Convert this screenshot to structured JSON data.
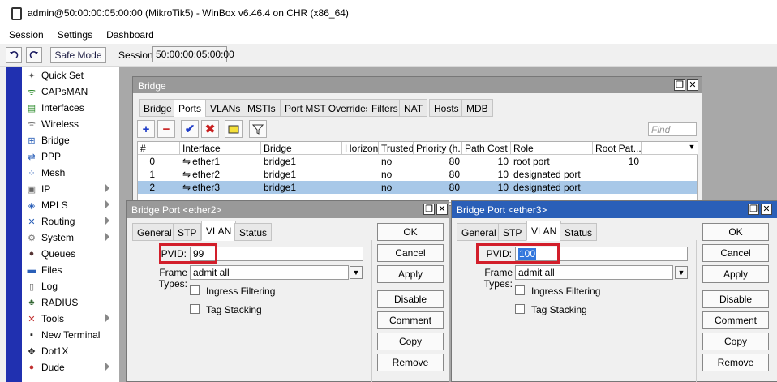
{
  "window": {
    "title": "admin@50:00:00:05:00:00 (MikroTik5) - WinBox v6.46.4 on CHR (x86_64)"
  },
  "menu": [
    "Session",
    "Settings",
    "Dashboard"
  ],
  "toolbar": {
    "undo_icon": "undo-icon",
    "redo_icon": "redo-icon",
    "safe_mode": "Safe Mode",
    "session_label": "Session:",
    "session_value": "50:00:00:05:00:00"
  },
  "sidebar": [
    {
      "label": "Quick Set",
      "icon": "wand-icon",
      "arrow": false
    },
    {
      "label": "CAPsMAN",
      "icon": "antenna-icon",
      "arrow": false
    },
    {
      "label": "Interfaces",
      "icon": "interfaces-icon",
      "arrow": false
    },
    {
      "label": "Wireless",
      "icon": "wireless-icon",
      "arrow": false
    },
    {
      "label": "Bridge",
      "icon": "bridge-icon",
      "arrow": false
    },
    {
      "label": "PPP",
      "icon": "ppp-icon",
      "arrow": false
    },
    {
      "label": "Mesh",
      "icon": "mesh-icon",
      "arrow": false
    },
    {
      "label": "IP",
      "icon": "ip-icon",
      "arrow": true
    },
    {
      "label": "MPLS",
      "icon": "mpls-icon",
      "arrow": true
    },
    {
      "label": "Routing",
      "icon": "routing-icon",
      "arrow": true
    },
    {
      "label": "System",
      "icon": "gear-icon",
      "arrow": true
    },
    {
      "label": "Queues",
      "icon": "queues-icon",
      "arrow": false
    },
    {
      "label": "Files",
      "icon": "folder-icon",
      "arrow": false
    },
    {
      "label": "Log",
      "icon": "log-icon",
      "arrow": false
    },
    {
      "label": "RADIUS",
      "icon": "radius-icon",
      "arrow": false
    },
    {
      "label": "Tools",
      "icon": "tools-icon",
      "arrow": true
    },
    {
      "label": "New Terminal",
      "icon": "terminal-icon",
      "arrow": false
    },
    {
      "label": "Dot1X",
      "icon": "dot1x-icon",
      "arrow": false
    },
    {
      "label": "Dude",
      "icon": "dude-icon",
      "arrow": true
    }
  ],
  "bridge_window": {
    "title": "Bridge",
    "tabs": [
      "Bridge",
      "Ports",
      "VLANs",
      "MSTIs",
      "Port MST Overrides",
      "Filters",
      "NAT",
      "Hosts",
      "MDB"
    ],
    "active_tab": "Ports",
    "find_placeholder": "Find",
    "columns": [
      "#",
      "",
      "Interface",
      "Bridge",
      "Horizon",
      "Trusted",
      "Priority (h...",
      "Path Cost",
      "Role",
      "Root Pat..."
    ],
    "rows": [
      {
        "num": "0",
        "flag": "",
        "interface": "ether1",
        "bridge": "bridge1",
        "horizon": "",
        "trusted": "no",
        "priority": "80",
        "path_cost": "10",
        "role": "root port",
        "root_path": "10"
      },
      {
        "num": "1",
        "flag": "",
        "interface": "ether2",
        "bridge": "bridge1",
        "horizon": "",
        "trusted": "no",
        "priority": "80",
        "path_cost": "10",
        "role": "designated port",
        "root_path": ""
      },
      {
        "num": "2",
        "flag": "",
        "interface": "ether3",
        "bridge": "bridge1",
        "horizon": "",
        "trusted": "no",
        "priority": "80",
        "path_cost": "10",
        "role": "designated port",
        "root_path": ""
      }
    ]
  },
  "dialog_left": {
    "title": "Bridge Port <ether2>",
    "tabs": [
      "General",
      "STP",
      "VLAN",
      "Status"
    ],
    "active_tab": "VLAN",
    "pvid_label": "PVID:",
    "pvid_value": "99",
    "frame_types_label": "Frame Types:",
    "frame_types_value": "admit all",
    "ingress_filtering": "Ingress Filtering",
    "tag_stacking": "Tag Stacking",
    "buttons": [
      "OK",
      "Cancel",
      "Apply",
      "Disable",
      "Comment",
      "Copy",
      "Remove"
    ]
  },
  "dialog_right": {
    "title": "Bridge Port <ether3>",
    "tabs": [
      "General",
      "STP",
      "VLAN",
      "Status"
    ],
    "active_tab": "VLAN",
    "pvid_label": "PVID:",
    "pvid_value": "100",
    "frame_types_label": "Frame Types:",
    "frame_types_value": "admit all",
    "ingress_filtering": "Ingress Filtering",
    "tag_stacking": "Tag Stacking",
    "buttons": [
      "OK",
      "Cancel",
      "Apply",
      "Disable",
      "Comment",
      "Copy",
      "Remove"
    ]
  },
  "colors": {
    "highlight_red": "#d21e2a",
    "selection_blue": "#a8c8e8",
    "sidebar_strip": "#2030b0"
  }
}
